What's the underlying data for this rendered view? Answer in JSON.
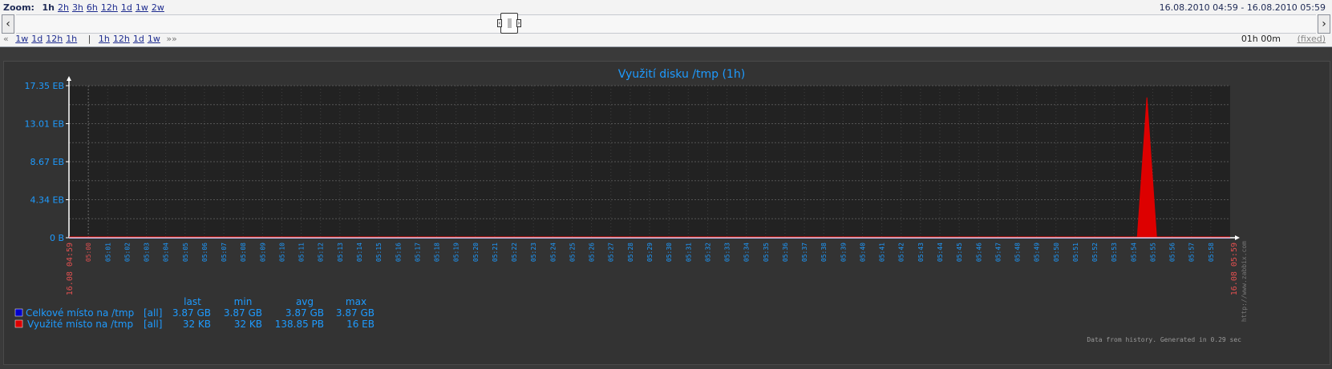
{
  "nav": {
    "zoom_label": "Zoom:",
    "zoom_links": [
      "1h",
      "2h",
      "3h",
      "6h",
      "12h",
      "1d",
      "1w",
      "2w"
    ],
    "zoom_active": "1h",
    "period_from": "16.08.2010 04:59",
    "period_sep": " - ",
    "period_to": "16.08.2010 05:59",
    "back_links": [
      "1w",
      "1d",
      "12h",
      "1h"
    ],
    "fwd_links": [
      "1h",
      "12h",
      "1d",
      "1w"
    ],
    "back_chevron": "«",
    "fwd_chevron": "»»",
    "period_length": "01h 00m",
    "fixed_label": "(fixed)"
  },
  "graph": {
    "title": "Využití disku /tmp  (1h)",
    "start_label": "16.08 04:59",
    "end_label": "16.08 05:59",
    "watermark": "http://www.zabbix.com",
    "footer": "Data from history. Generated in 0.29 sec"
  },
  "chart_data": {
    "type": "area",
    "title": "Využití disku /tmp  (1h)",
    "xlabel": "",
    "ylabel": "",
    "y_ticks": [
      "0 B",
      "4.34 EB",
      "8.67 EB",
      "13.01 EB",
      "17.35 EB"
    ],
    "ylim": [
      0,
      17.35
    ],
    "x_ticks": [
      "05:00",
      "05:01",
      "05:02",
      "05:03",
      "05:04",
      "05:05",
      "05:06",
      "05:07",
      "05:08",
      "05:09",
      "05:10",
      "05:11",
      "05:12",
      "05:13",
      "05:14",
      "05:15",
      "05:16",
      "05:17",
      "05:18",
      "05:19",
      "05:20",
      "05:21",
      "05:22",
      "05:23",
      "05:24",
      "05:25",
      "05:26",
      "05:27",
      "05:28",
      "05:29",
      "05:30",
      "05:31",
      "05:32",
      "05:33",
      "05:34",
      "05:35",
      "05:36",
      "05:37",
      "05:38",
      "05:39",
      "05:40",
      "05:41",
      "05:42",
      "05:43",
      "05:44",
      "05:45",
      "05:46",
      "05:47",
      "05:48",
      "05:49",
      "05:50",
      "05:51",
      "05:52",
      "05:53",
      "05:54",
      "05:55",
      "05:56",
      "05:57",
      "05:58"
    ],
    "grid": true,
    "series": [
      {
        "name": "Celkové místo na /tmp",
        "color": "#0000cc",
        "x": [
          0,
          60
        ],
        "y": [
          0,
          0
        ],
        "stats": {
          "scope": "[all]",
          "last": "3.87 GB",
          "min": "3.87 GB",
          "avg": "3.87 GB",
          "max": "3.87 GB"
        }
      },
      {
        "name": "Využité místo na /tmp",
        "color": "#dd0000",
        "x": [
          0,
          55.2,
          55.7,
          56.2,
          60
        ],
        "y": [
          0,
          0,
          16,
          0,
          0
        ],
        "stats": {
          "scope": "[all]",
          "last": "32 KB",
          "min": "32 KB",
          "avg": "138.85 PB",
          "max": "16 EB"
        }
      }
    ],
    "legend_headers": [
      "last",
      "min",
      "avg",
      "max"
    ],
    "legend_placement": "bottom-left"
  }
}
